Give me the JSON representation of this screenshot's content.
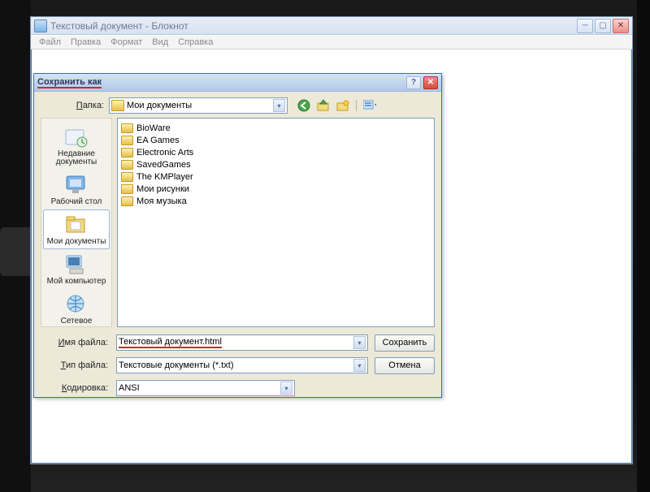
{
  "window": {
    "title": "Текстовый документ - Блокнот",
    "menu": [
      "Файл",
      "Правка",
      "Формат",
      "Вид",
      "Справка"
    ]
  },
  "dialog": {
    "title": "Сохранить как",
    "folder_label": "Папка:",
    "folder_value": "Мои документы",
    "files": [
      "BioWare",
      "EA Games",
      "Electronic Arts",
      "SavedGames",
      "The KMPlayer",
      "Мои рисунки",
      "Моя музыка"
    ],
    "places": [
      "Недавние документы",
      "Рабочий стол",
      "Мои документы",
      "Мой компьютер",
      "Сетевое"
    ],
    "filename_label": "Имя файла:",
    "filename_value": "Текстовый документ.html",
    "filetype_label": "Тип файла:",
    "filetype_value": "Текстовые документы (*.txt)",
    "encoding_label": "Кодировка:",
    "encoding_value": "ANSI",
    "save_btn": "Сохранить",
    "cancel_btn": "Отмена"
  }
}
